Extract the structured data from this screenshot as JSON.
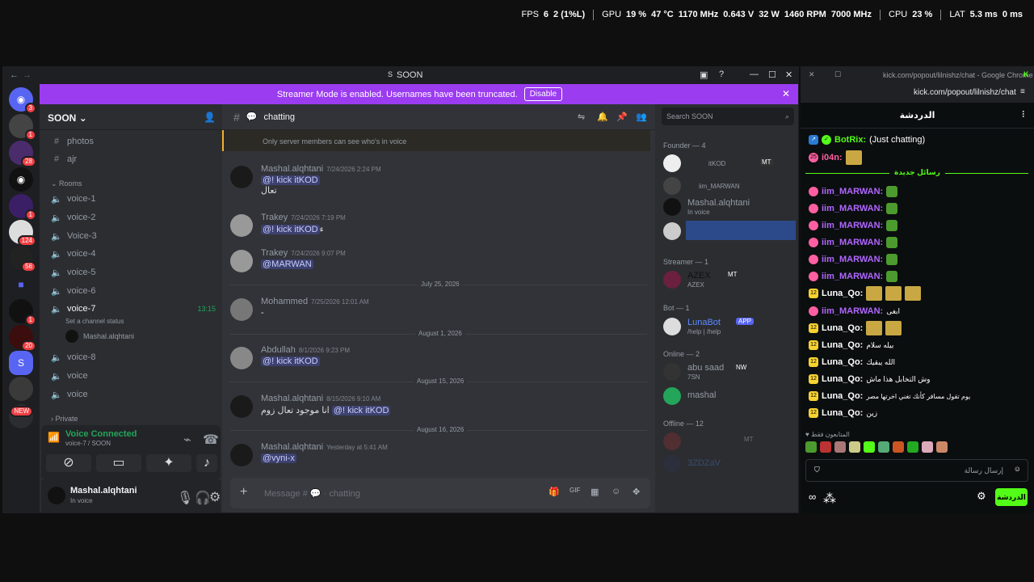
{
  "overlay": {
    "fps_label": "FPS",
    "fps": "6",
    "fps_low": "2 (1%L)",
    "gpu_label": "GPU",
    "gpu_load": "19 %",
    "gpu_temp": "47 °C",
    "gpu_clock": "1170 MHz",
    "gpu_volt": "0.643 V",
    "gpu_power": "32 W",
    "fan": "1460 RPM",
    "mem_clock": "7000 MHz",
    "cpu_label": "CPU",
    "cpu_load": "23 %",
    "lat_label": "LAT",
    "lat1": "5.3 ms",
    "lat2": "0 ms"
  },
  "discord": {
    "title": "SOON",
    "banner": {
      "text": "Streamer Mode is enabled. Usernames have been truncated.",
      "disable": "Disable"
    },
    "server_badges": [
      "3",
      "1",
      "28",
      "1",
      "124",
      "56",
      "1",
      "20",
      "NEW"
    ],
    "server_name": "SOON",
    "channels": [
      {
        "icon": "#",
        "label": "photos"
      },
      {
        "icon": "#",
        "label": "ajr"
      }
    ],
    "rooms_label": "Rooms",
    "voice_channels": [
      "voice-1",
      "voice-2",
      "Voice-3",
      "voice-4",
      "voice-5",
      "voice-6",
      "voice-7",
      "voice-8",
      "voice",
      "voice"
    ],
    "voice7_timer": "13:15",
    "voice7_status": "Set a channel status",
    "voice7_user": "Mashal.alqhtani",
    "private_label": "Private",
    "voice_panel": {
      "title": "Voice Connected",
      "sub": "voice-7 / SOON"
    },
    "user": {
      "name": "Mashal.alqhtani",
      "status": "In voice"
    },
    "chat_channel": "chatting",
    "search_placeholder": "Search SOON",
    "notice": "Only server members can see who's in voice",
    "messages": [
      {
        "name": "Mashal.alqhtani",
        "ts": "7/24/2026 2:24 PM",
        "mention": "@! kick itKOD",
        "text": "تعال"
      },
      {
        "name": "Trakey",
        "ts": "7/24/2026 7:19 PM",
        "mention": "@! kick itKOD",
        "text": "ء"
      },
      {
        "name": "Trakey",
        "ts": "7/24/2026 9:07 PM",
        "mention": "@MARWAN",
        "text": ""
      },
      {
        "name": "Mohammed",
        "ts": "7/25/2026 12:01 AM",
        "mention": "",
        "text": "-"
      },
      {
        "name": "Abdullah",
        "ts": "8/1/2026 9:23 PM",
        "mention": "@! kick itKOD",
        "text": ""
      },
      {
        "name": "Mashal.alqhtani",
        "ts": "8/15/2026 9:10 AM",
        "mention": "@! kick itKOD",
        "text": "انا موجود تعال زوم"
      },
      {
        "name": "Mashal.alqhtani",
        "ts": "Yesterday at 5:41 AM",
        "mention": "@vyni-x",
        "text": ""
      }
    ],
    "dividers": [
      "July 25, 2026",
      "August 1, 2026",
      "August 15, 2026",
      "August 16, 2026"
    ],
    "input_placeholder": "Message #",
    "input_channel": "chatting",
    "members": {
      "founder_header": "Founder — 4",
      "founders": [
        {
          "name": "itKOD",
          "tag": "MT"
        },
        {
          "name": "iim_MARWAN",
          "tag": ""
        },
        {
          "name": "Mashal.alqhtani",
          "sub": "In voice"
        },
        {
          "name": "",
          "sub": ""
        }
      ],
      "streamer_header": "Streamer — 1",
      "streamer": {
        "name": "AZEX",
        "sub": "AZEX",
        "tag": "MT"
      },
      "bot_header": "Bot — 1",
      "bot": {
        "name": "LunaBot",
        "tag": "APP",
        "sub": "/help | /help"
      },
      "online_header": "Online — 2",
      "online": [
        {
          "name": "abu saad",
          "tag": "NW",
          "sub": "7SN"
        },
        {
          "name": "mashal",
          "sub": ""
        }
      ],
      "offline_header": "Offline — 12",
      "offline": [
        {
          "name": "",
          "tag": "MT"
        },
        {
          "name": "3ZDZaV"
        }
      ]
    }
  },
  "kick": {
    "window_title": "kick.com/popout/lilnishz/chat - Google Chrome",
    "url": "kick.com/popout/lilnishz/chat",
    "header": "الدردشة",
    "pinned": [
      {
        "user": "BotRix:",
        "text": "(Just chatting)"
      },
      {
        "user": "i04n:",
        "text": ""
      }
    ],
    "new_messages": "رسائل جديدة",
    "messages": [
      {
        "user": "iim_MARWAN:",
        "text": "",
        "badge": "3",
        "color": "#b066ff"
      },
      {
        "user": "iim_MARWAN:",
        "text": "",
        "badge": "3",
        "color": "#b066ff"
      },
      {
        "user": "iim_MARWAN:",
        "text": "",
        "badge": "3",
        "color": "#b066ff"
      },
      {
        "user": "iim_MARWAN:",
        "text": "",
        "badge": "3",
        "color": "#b066ff"
      },
      {
        "user": "iim_MARWAN:",
        "text": "",
        "badge": "3",
        "color": "#b066ff"
      },
      {
        "user": "iim_MARWAN:",
        "text": "",
        "badge": "3",
        "color": "#b066ff"
      },
      {
        "user": "Luna_Qo:",
        "text": "",
        "badge": "12",
        "color": "#ffffff"
      },
      {
        "user": "iim_MARWAN:",
        "text": "ابغى",
        "badge": "3",
        "color": "#b066ff"
      },
      {
        "user": "Luna_Qo:",
        "text": "",
        "badge": "12",
        "color": "#ffffff"
      },
      {
        "user": "Luna_Qo:",
        "text": "بيله سلام",
        "badge": "12",
        "color": "#ffffff"
      },
      {
        "user": "Luna_Qo:",
        "text": "الله يبقيك",
        "badge": "12",
        "color": "#ffffff"
      },
      {
        "user": "Luna_Qo:",
        "text": "وش التخابل هذا ماش",
        "badge": "12",
        "color": "#ffffff"
      },
      {
        "user": "Luna_Qo:",
        "text": "يوم تقول مسافر كأنك تغني اخرتها مصر",
        "badge": "12",
        "color": "#ffffff"
      },
      {
        "user": "Luna_Qo:",
        "text": "زين",
        "badge": "12",
        "color": "#ffffff"
      }
    ],
    "followers_label": "المتابعون فقط",
    "input_placeholder": "إرسال رسالة",
    "chat_button": "الدردشة"
  }
}
